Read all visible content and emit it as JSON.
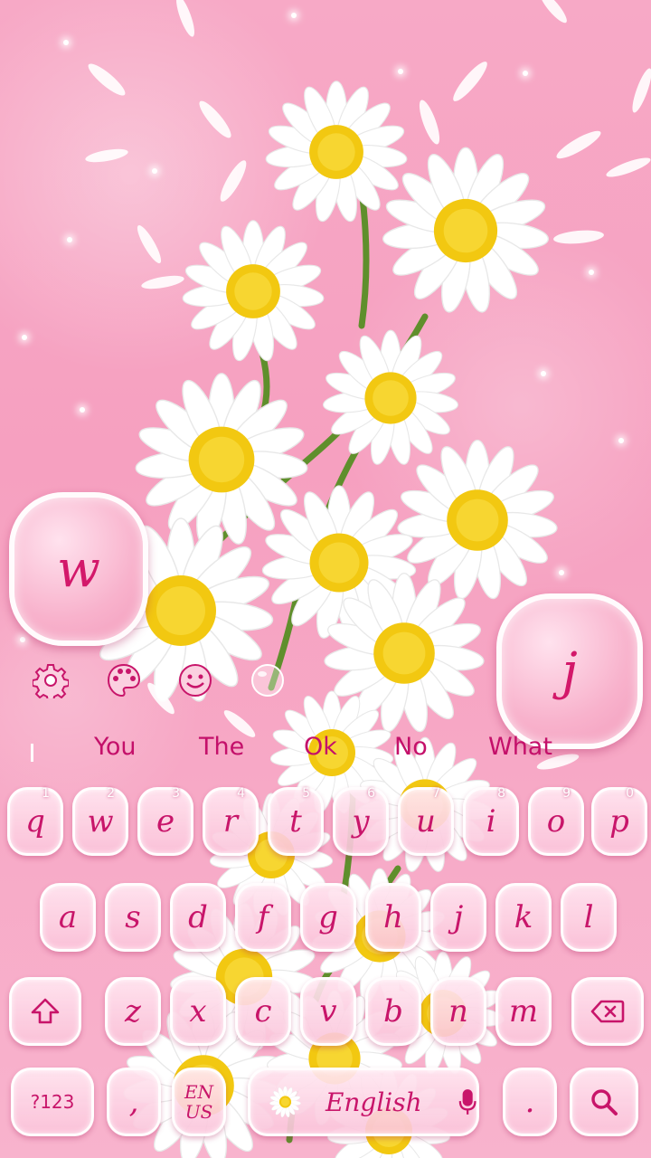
{
  "theme": {
    "accent": "#c8156a",
    "background": "#f7a9c6",
    "key_fill": "#fbd0e0"
  },
  "bubbles": {
    "left_letter": "w",
    "right_letter": "j"
  },
  "toolbar": {
    "settings_icon": "gear-icon",
    "theme_icon": "palette-icon",
    "emoji_icon": "smiley-icon",
    "extra_icon": "bubble-icon"
  },
  "suggestions": [
    "You",
    "The",
    "Ok",
    "No",
    "What"
  ],
  "keyboard": {
    "row1": [
      {
        "letter": "q",
        "hint": "1"
      },
      {
        "letter": "w",
        "hint": "2"
      },
      {
        "letter": "e",
        "hint": "3"
      },
      {
        "letter": "r",
        "hint": "4"
      },
      {
        "letter": "t",
        "hint": "5"
      },
      {
        "letter": "y",
        "hint": "6"
      },
      {
        "letter": "u",
        "hint": "7"
      },
      {
        "letter": "i",
        "hint": "8"
      },
      {
        "letter": "o",
        "hint": "9"
      },
      {
        "letter": "p",
        "hint": "0"
      }
    ],
    "row2": [
      "a",
      "s",
      "d",
      "f",
      "g",
      "h",
      "j",
      "k",
      "l"
    ],
    "row3": [
      "z",
      "x",
      "c",
      "v",
      "b",
      "n",
      "m"
    ],
    "symbols_label": "?123",
    "comma_label": ",",
    "lang_label_top": "EN",
    "lang_label_bottom": "US",
    "space_label": "English",
    "period_label": ".",
    "shift_icon": "shift-arrow-icon",
    "delete_icon": "backspace-icon",
    "search_icon": "search-icon"
  }
}
